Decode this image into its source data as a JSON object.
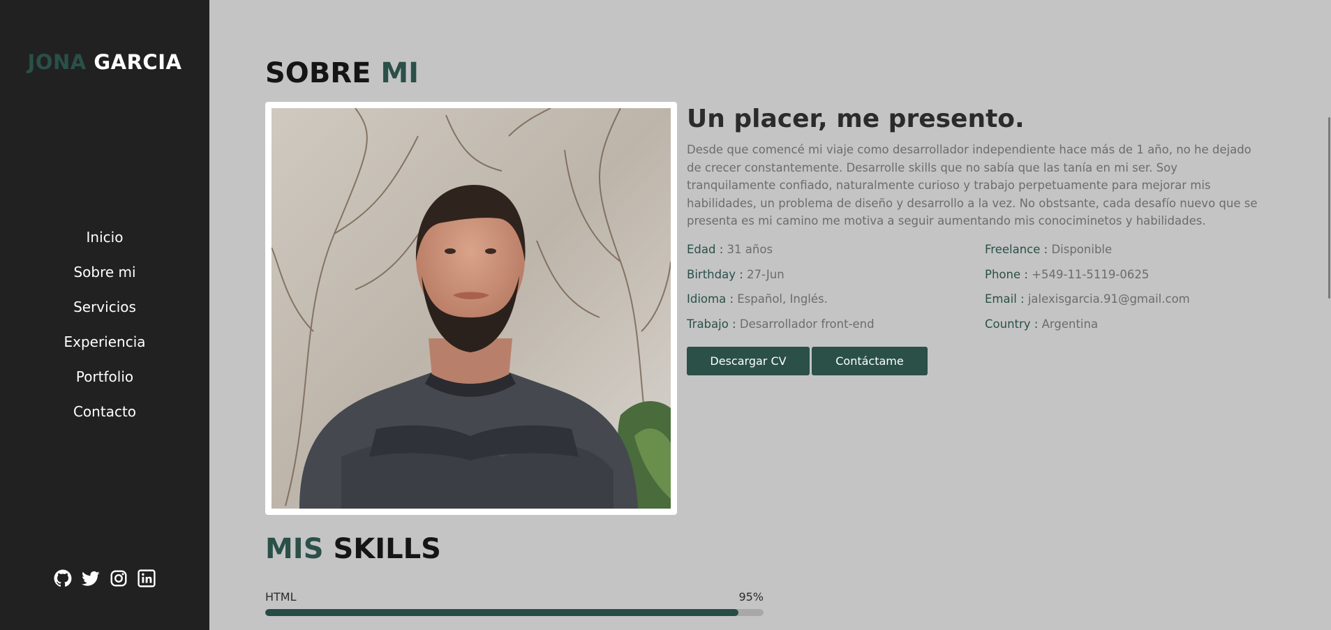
{
  "sidebar": {
    "logo_first": "JONA",
    "logo_last": "GARCIA",
    "nav": [
      "Inicio",
      "Sobre mi",
      "Servicios",
      "Experiencia",
      "Portfolio",
      "Contacto"
    ],
    "social_icons": [
      "github-icon",
      "twitter-icon",
      "instagram-icon",
      "linkedin-icon"
    ]
  },
  "about": {
    "title_main": "SOBRE",
    "title_accent": "MI",
    "photo_icon": "profile-photo",
    "heading": "Un placer, me presento.",
    "text": "Desde que comencé mi viaje como desarrollador independiente hace más de 1 año, no he dejado de crecer constantemente. Desarrolle skills que no sabía que las tanía en mi ser. Soy tranquilamente confiado, naturalmente curioso y trabajo perpetuamente para mejorar mis habilidades, un problema de diseño y desarrollo a la vez. No obstsante, cada desafío nuevo que se presenta es mi camino me motiva a seguir aumentando mis conociminetos y habilidades.",
    "info": [
      {
        "key": "Edad :",
        "value": " 31 años"
      },
      {
        "key": "Freelance :",
        "value": " Disponible"
      },
      {
        "key": "Birthday :",
        "value": " 27-Jun"
      },
      {
        "key": "Phone :",
        "value": " +549-11-5119-0625"
      },
      {
        "key": "Idioma :",
        "value": " Español, Inglés."
      },
      {
        "key": "Email :",
        "value": " jalexisgarcia.91@gmail.com"
      },
      {
        "key": "Trabajo :",
        "value": " Desarrollador front-end"
      },
      {
        "key": "Country :",
        "value": " Argentina"
      }
    ],
    "btn_cv": "Descargar CV",
    "btn_contact": "Contáctame"
  },
  "skills": {
    "title_accent": "MIS",
    "title_main": "SKILLS",
    "items": [
      {
        "name": "HTML",
        "percent_label": "95%",
        "level": 0.95
      }
    ]
  },
  "colors": {
    "accent": "#2a5048",
    "sidebar_bg": "#212121",
    "page_bg": "#c4c4c4"
  }
}
